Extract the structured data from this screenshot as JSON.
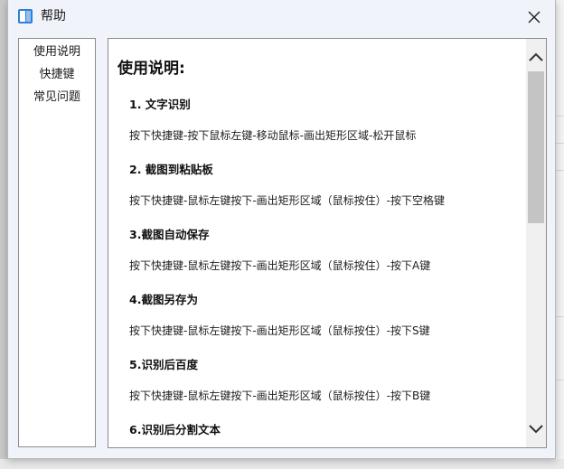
{
  "window": {
    "title": "帮助"
  },
  "sidebar": {
    "items": [
      {
        "label": "使用说明"
      },
      {
        "label": "快捷键"
      },
      {
        "label": "常见问题"
      }
    ]
  },
  "content": {
    "heading": "使用说明:",
    "sections": [
      {
        "title": "1. 文字识别",
        "text": "按下快捷键-按下鼠标左键-移动鼠标-画出矩形区域-松开鼠标"
      },
      {
        "title": "2. 截图到粘贴板",
        "text": "按下快捷键-鼠标左键按下-画出矩形区域（鼠标按住）-按下空格键"
      },
      {
        "title": "3.截图自动保存",
        "text": "按下快捷键-鼠标左键按下-画出矩形区域（鼠标按住）-按下A键"
      },
      {
        "title": "4.截图另存为",
        "text": "按下快捷键-鼠标左键按下-画出矩形区域（鼠标按住）-按下S键"
      },
      {
        "title": "5.识别后百度",
        "text": "按下快捷键-鼠标左键按下-画出矩形区域（鼠标按住）-按下B键"
      },
      {
        "title": "6.识别后分割文本",
        "text": ""
      }
    ]
  },
  "colors": {
    "window_bg": "#f0f3f9",
    "panel_border": "#8c8c8c",
    "scroll_thumb": "#c4c4c4",
    "app_icon_blue": "#2f7fd6"
  },
  "icons": {
    "app": "help-app-icon",
    "close": "close-icon",
    "scroll_up": "chevron-up-icon",
    "scroll_down": "chevron-down-icon"
  }
}
